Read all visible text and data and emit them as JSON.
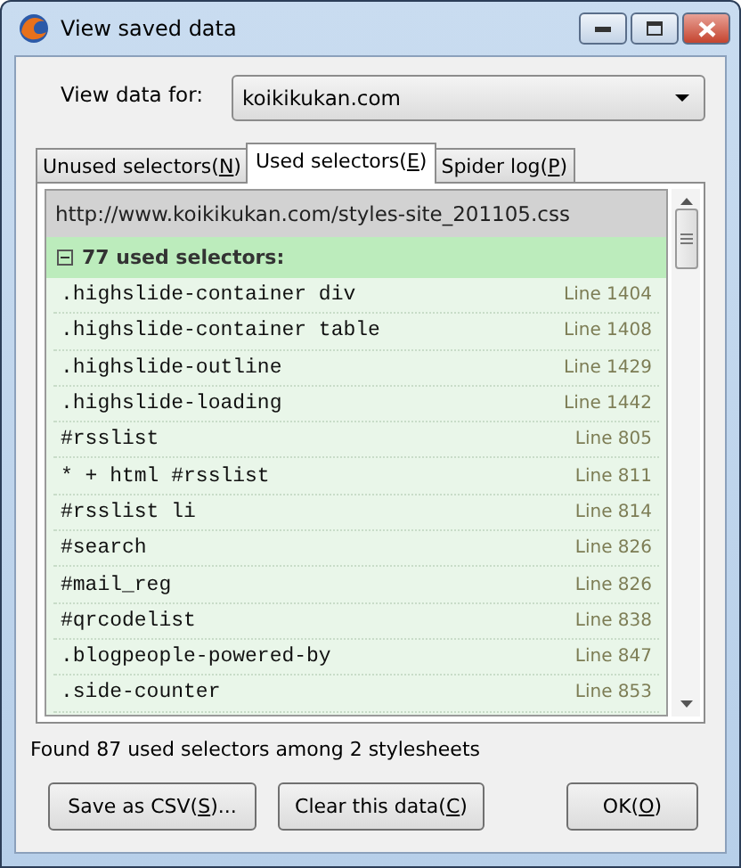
{
  "window": {
    "title": "View saved data"
  },
  "site_picker": {
    "label": "View data for:",
    "value": "koikikukan.com"
  },
  "tabs": [
    {
      "label": "Unused selectors(N)",
      "selected": false
    },
    {
      "label": "Used selectors(E)",
      "selected": true
    },
    {
      "label": "Spider log(P)",
      "selected": false
    }
  ],
  "stylesheet": {
    "url": "http://www.koikikukan.com/styles-site_201105.css",
    "group": {
      "label": "77 used selectors:",
      "expanded": true
    },
    "rows": [
      {
        "selector": ".highslide-container div",
        "line": "Line 1404"
      },
      {
        "selector": ".highslide-container table",
        "line": "Line 1408"
      },
      {
        "selector": ".highslide-outline",
        "line": "Line 1429"
      },
      {
        "selector": ".highslide-loading",
        "line": "Line 1442"
      },
      {
        "selector": "#rsslist",
        "line": "Line 805"
      },
      {
        "selector": "* + html #rsslist",
        "line": "Line 811"
      },
      {
        "selector": "#rsslist li",
        "line": "Line 814"
      },
      {
        "selector": "#search",
        "line": "Line 826"
      },
      {
        "selector": "#mail_reg",
        "line": "Line 826"
      },
      {
        "selector": "#qrcodelist",
        "line": "Line 838"
      },
      {
        "selector": ".blogpeople-powered-by",
        "line": "Line 847"
      },
      {
        "selector": ".side-counter",
        "line": "Line 853"
      }
    ]
  },
  "status": "Found 87 used selectors among 2 stylesheets",
  "buttons": [
    "Save as CSV(S)...",
    "Clear this data(C)",
    "OK(O)"
  ]
}
